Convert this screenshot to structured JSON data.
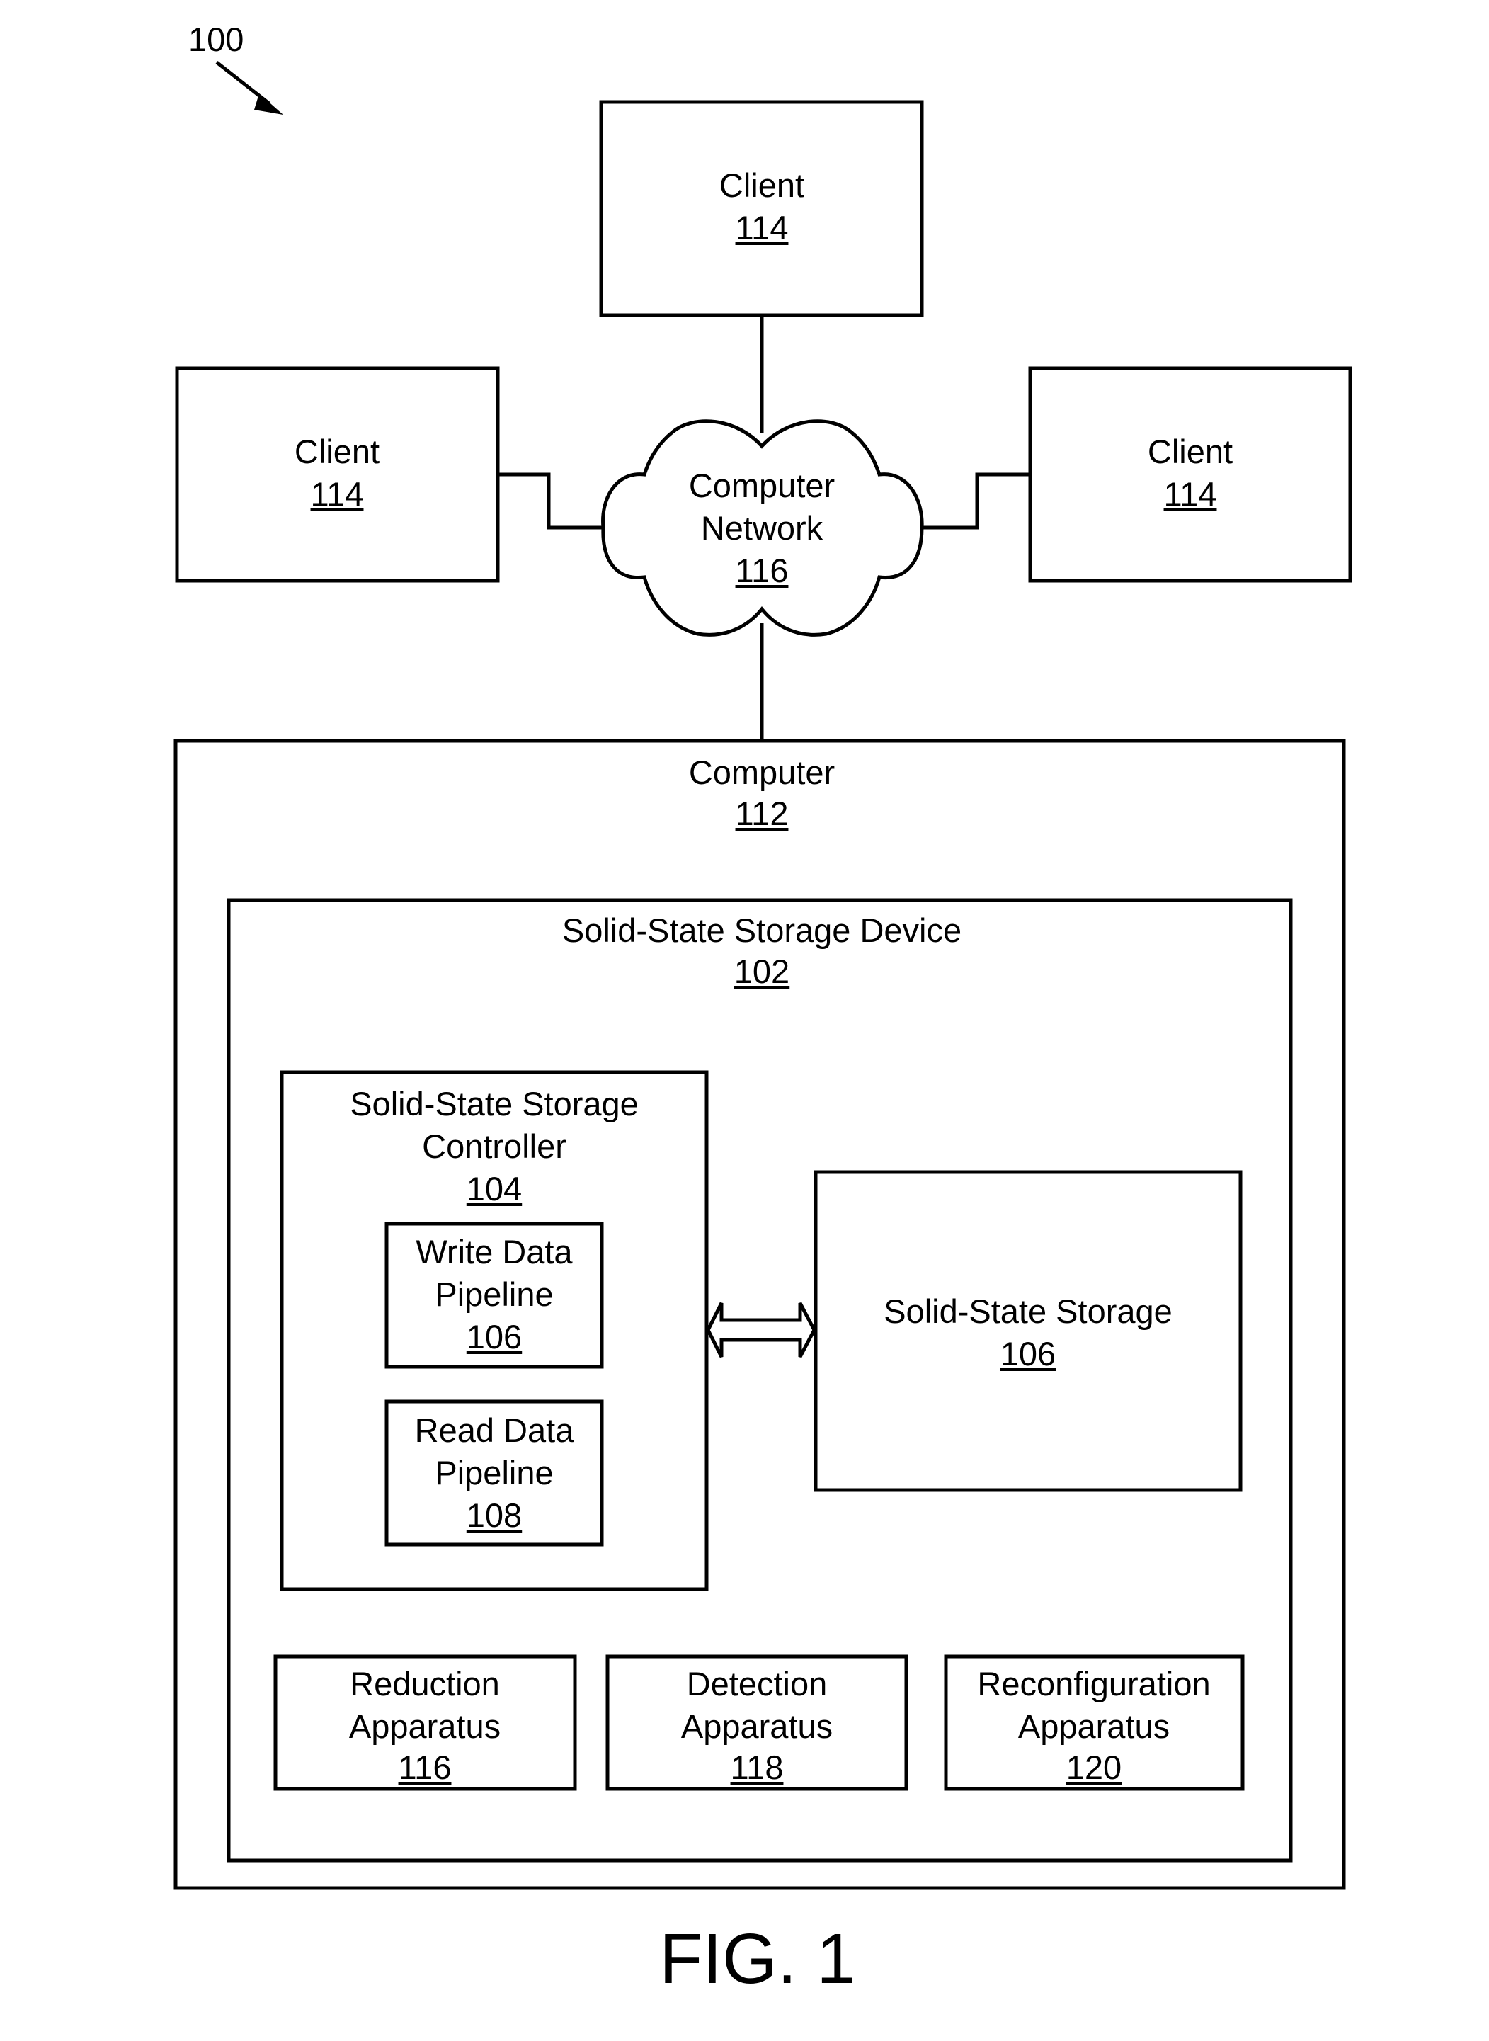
{
  "figure": {
    "reference_numeral": "100",
    "caption": "FIG. 1"
  },
  "clients": [
    {
      "label": "Client",
      "ref": "114",
      "position": "top"
    },
    {
      "label": "Client",
      "ref": "114",
      "position": "left"
    },
    {
      "label": "Client",
      "ref": "114",
      "position": "right"
    }
  ],
  "network": {
    "lines": [
      "Computer",
      "Network"
    ],
    "ref": "116"
  },
  "computer": {
    "lines": [
      "Computer"
    ],
    "ref": "112"
  },
  "ssd": {
    "lines": [
      "Solid-State Storage Device"
    ],
    "ref": "102"
  },
  "controller": {
    "lines": [
      "Solid-State Storage",
      "Controller"
    ],
    "ref": "104"
  },
  "write_pipeline": {
    "lines": [
      "Write Data",
      "Pipeline"
    ],
    "ref": "106"
  },
  "read_pipeline": {
    "lines": [
      "Read Data",
      "Pipeline"
    ],
    "ref": "108"
  },
  "storage": {
    "lines": [
      "Solid-State Storage"
    ],
    "ref": "106"
  },
  "apparatus": [
    {
      "lines": [
        "Reduction",
        "Apparatus"
      ],
      "ref": "116"
    },
    {
      "lines": [
        "Detection",
        "Apparatus"
      ],
      "ref": "118"
    },
    {
      "lines": [
        "Reconfiguration",
        "Apparatus"
      ],
      "ref": "120"
    }
  ],
  "connections": [
    {
      "from": "client-top",
      "to": "network",
      "type": "line"
    },
    {
      "from": "client-left",
      "to": "network",
      "type": "line"
    },
    {
      "from": "client-right",
      "to": "network",
      "type": "line"
    },
    {
      "from": "network",
      "to": "computer",
      "type": "line"
    },
    {
      "from": "controller",
      "to": "storage",
      "type": "bidirectional-arrow"
    }
  ]
}
